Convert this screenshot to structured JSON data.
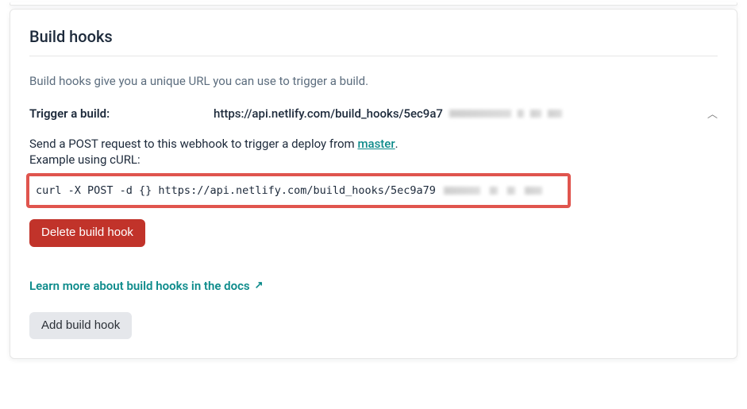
{
  "card": {
    "title": "Build hooks",
    "description": "Build hooks give you a unique URL you can use to trigger a build.",
    "trigger_label": "Trigger a build:",
    "trigger_url_visible": "https://api.netlify.com/build_hooks/5ec9a7",
    "send_prefix": "Send a POST request to this webhook to trigger a deploy from ",
    "branch": "master",
    "send_suffix": ".",
    "example_label": "Example using cURL:",
    "curl_visible": "curl -X POST -d {} https://api.netlify.com/build_hooks/5ec9a79",
    "delete_label": "Delete build hook",
    "docs_link": "Learn more about build hooks in the docs",
    "add_label": "Add build hook"
  },
  "colors": {
    "accent": "#0d8b8b",
    "danger": "#c1332a",
    "highlight_border": "#e0554e"
  }
}
